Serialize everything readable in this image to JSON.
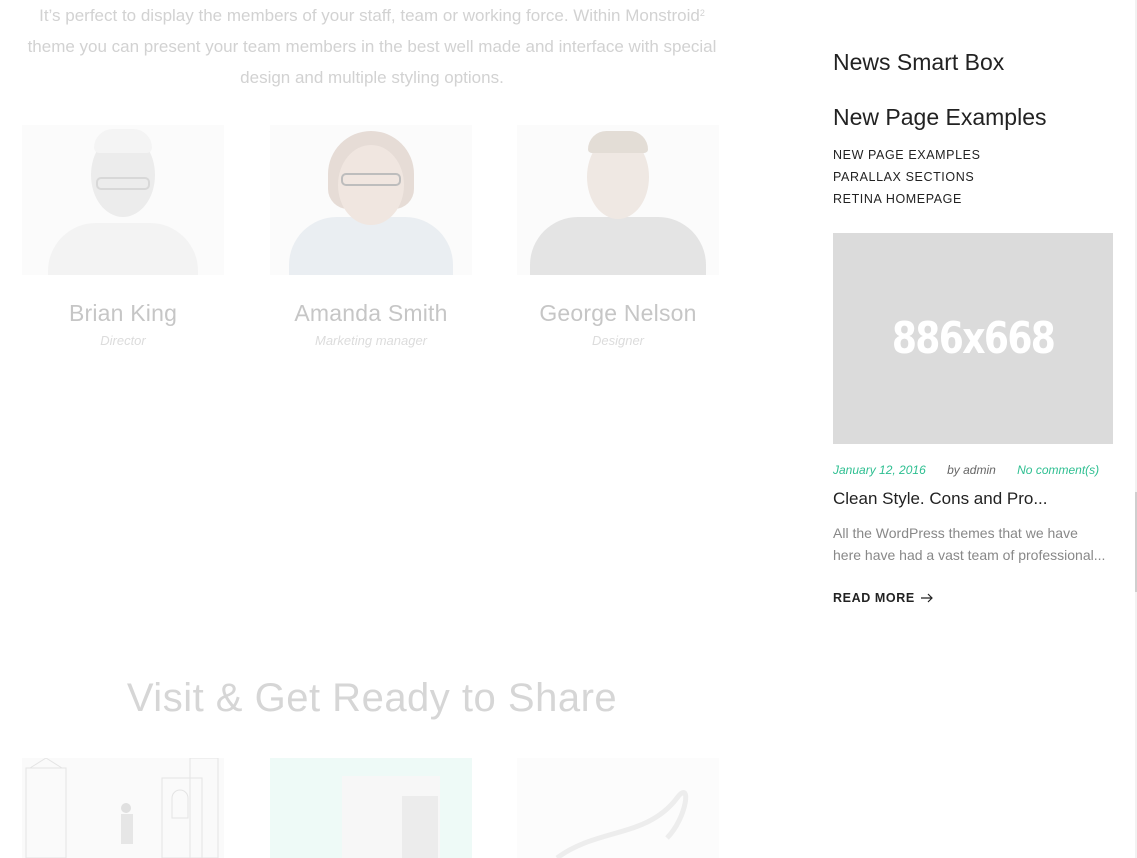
{
  "team_section": {
    "intro_line1": "It’s perfect to display the members of your staff, team or working force. Within Monstroid",
    "intro_superscript": "2",
    "intro_line2": "theme you can present your team members in the best well made and interface with special",
    "intro_line3": "design and multiple styling options.",
    "members": [
      {
        "name": "Brian King",
        "role": "Director"
      },
      {
        "name": "Amanda Smith",
        "role": "Marketing manager"
      },
      {
        "name": "George Nelson",
        "role": "Designer"
      }
    ]
  },
  "share_section": {
    "title": "Visit & Get Ready to Share"
  },
  "sidebar": {
    "news_widget_title": "News Smart Box",
    "pages_widget_title": "New Page Examples",
    "page_links": [
      "NEW PAGE EXAMPLES",
      "PARALLAX SECTIONS",
      "RETINA HOMEPAGE"
    ],
    "post": {
      "image_placeholder": "886x668",
      "date": "January 12, 2016",
      "author": "by admin",
      "comments": "No comment(s)",
      "title": "Clean Style. Cons and Pro...",
      "excerpt": "All the WordPress themes that we have here have had a vast team of professional...",
      "read_more": "READ MORE",
      "read_more_icon": "arrow-right-icon"
    }
  },
  "colors": {
    "accent": "#2ebf91",
    "placeholder_bg": "#dbdbdb",
    "faded_text": "#c6c6c6"
  }
}
